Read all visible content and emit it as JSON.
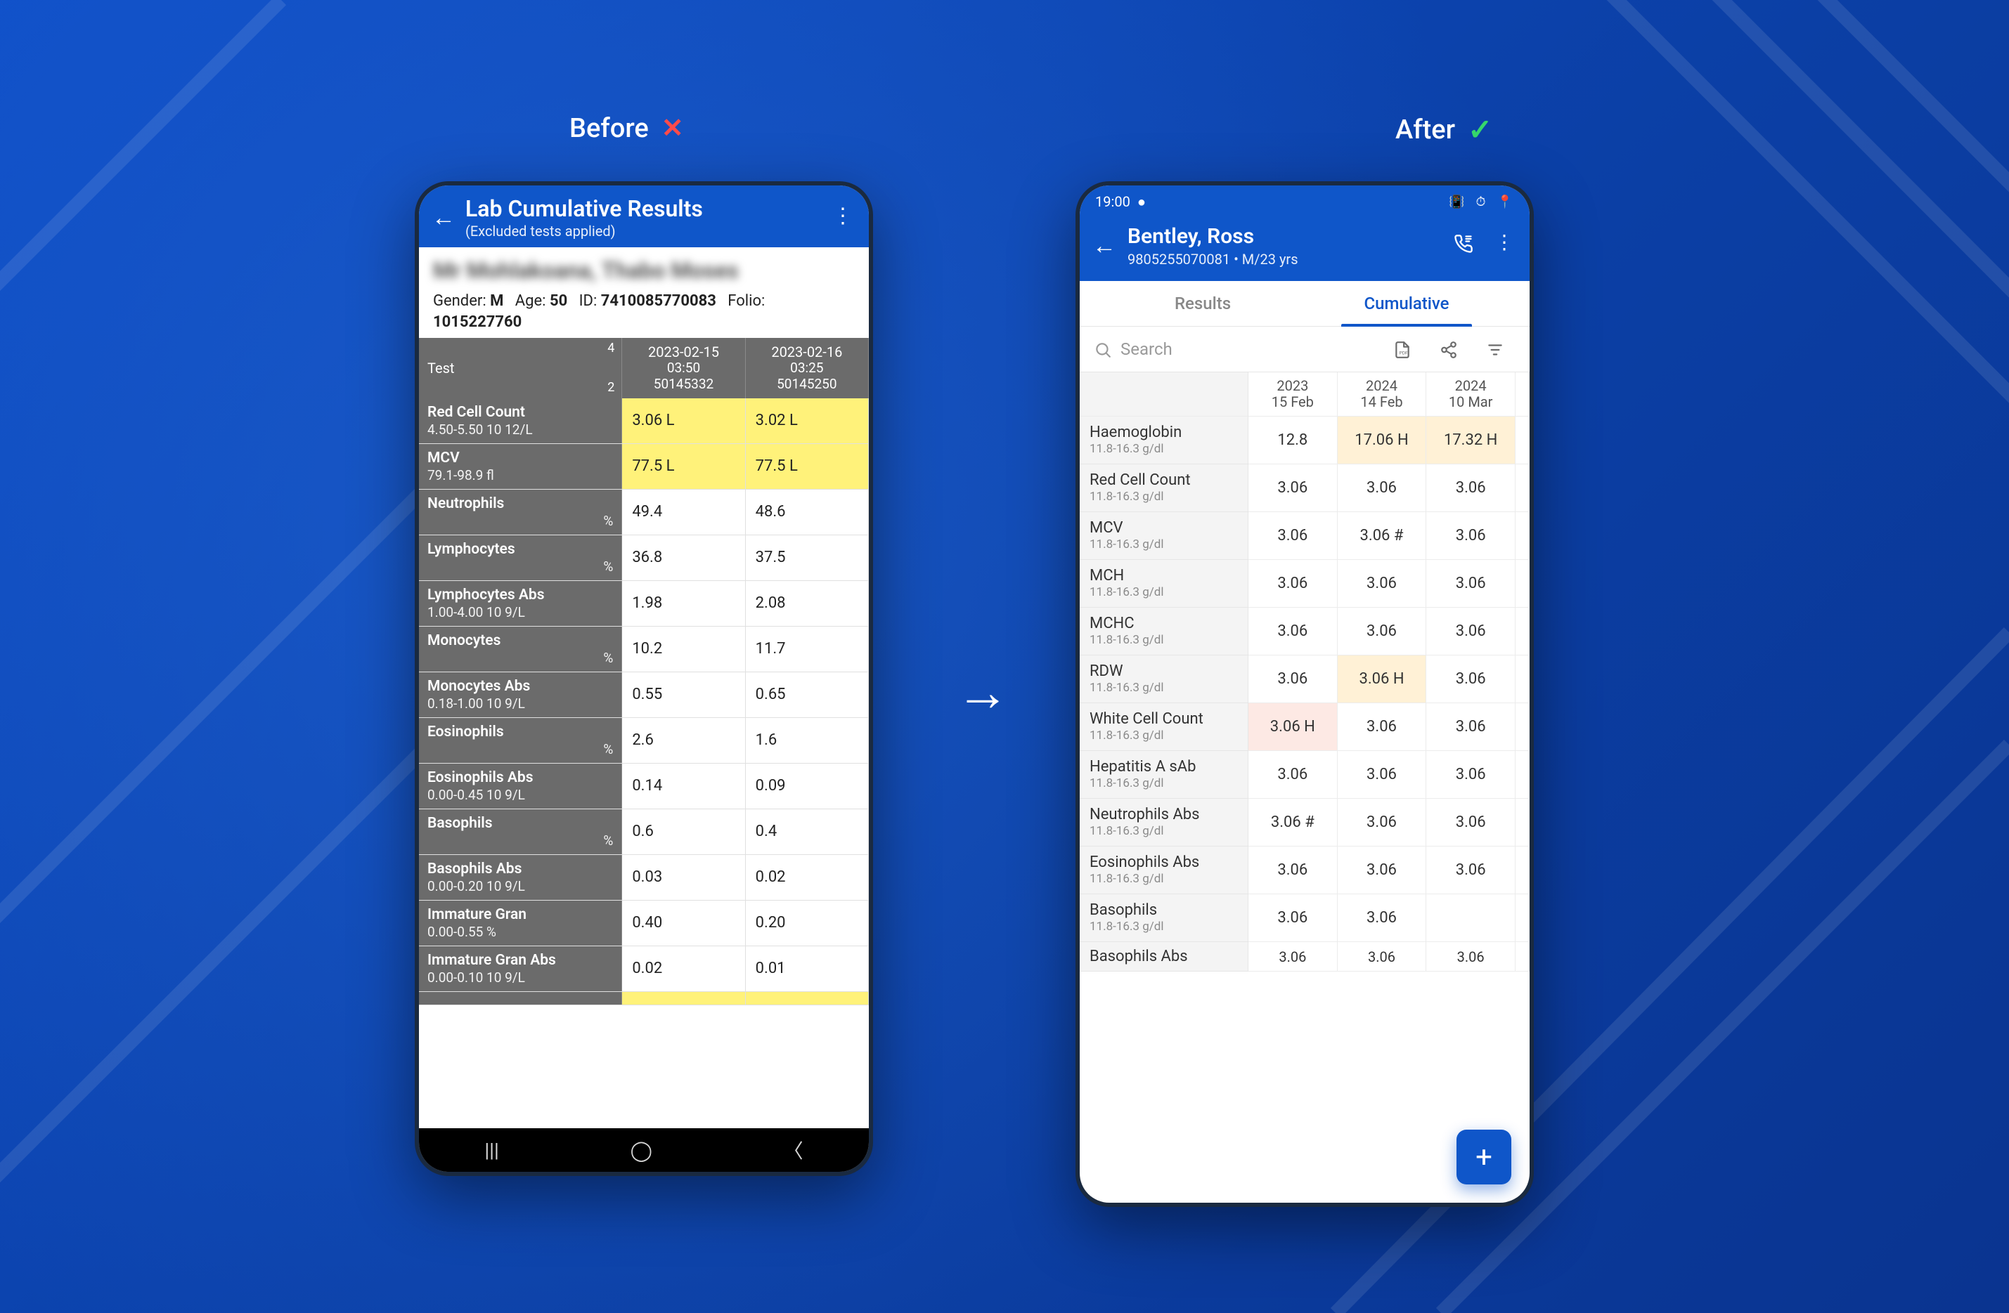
{
  "labels": {
    "before": "Before",
    "after": "After"
  },
  "before": {
    "appbar": {
      "title": "Lab Cumulative Results",
      "subtitle": "(Excluded tests applied)"
    },
    "patient": {
      "name_blur": "Mr Mohlakoana, Thabo Moses",
      "gender_label": "Gender:",
      "gender": "M",
      "age_label": "Age:",
      "age": "50",
      "id_label": "ID:",
      "id": "7410085770083",
      "folio_label": "Folio:",
      "folio": "1015227760"
    },
    "table": {
      "col_test_label": "Test",
      "corner_top": "4",
      "corner_bot": "2",
      "columns": [
        {
          "date": "2023-02-15",
          "time": "03:50",
          "acc": "50145332"
        },
        {
          "date": "2023-02-16",
          "time": "03:25",
          "acc": "50145250"
        }
      ],
      "rows": [
        {
          "name": "Red Cell Count",
          "range": "4.50-5.50    10 12/L",
          "unit_right": false,
          "v1": "3.06 L",
          "f1": true,
          "v2": "3.02 L",
          "f2": true
        },
        {
          "name": "MCV",
          "range": "79.1-98.9     fl",
          "unit_right": false,
          "v1": "77.5 L",
          "f1": true,
          "v2": "77.5 L",
          "f2": true
        },
        {
          "name": "Neutrophils",
          "range": "%",
          "unit_right": true,
          "v1": "49.4",
          "f1": false,
          "v2": "48.6",
          "f2": false
        },
        {
          "name": "Lymphocytes",
          "range": "%",
          "unit_right": true,
          "v1": "36.8",
          "f1": false,
          "v2": "37.5",
          "f2": false
        },
        {
          "name": "Lymphocytes Abs",
          "range": "1.00-4.00    10 9/L",
          "unit_right": false,
          "v1": "1.98",
          "f1": false,
          "v2": "2.08",
          "f2": false
        },
        {
          "name": "Monocytes",
          "range": "%",
          "unit_right": true,
          "v1": "10.2",
          "f1": false,
          "v2": "11.7",
          "f2": false
        },
        {
          "name": "Monocytes Abs",
          "range": "0.18-1.00    10 9/L",
          "unit_right": false,
          "v1": "0.55",
          "f1": false,
          "v2": "0.65",
          "f2": false
        },
        {
          "name": "Eosinophils",
          "range": "%",
          "unit_right": true,
          "v1": "2.6",
          "f1": false,
          "v2": "1.6",
          "f2": false
        },
        {
          "name": "Eosinophils Abs",
          "range": "0.00-0.45    10 9/L",
          "unit_right": false,
          "v1": "0.14",
          "f1": false,
          "v2": "0.09",
          "f2": false
        },
        {
          "name": "Basophils",
          "range": "%",
          "unit_right": true,
          "v1": "0.6",
          "f1": false,
          "v2": "0.4",
          "f2": false
        },
        {
          "name": "Basophils Abs",
          "range": "0.00-0.20    10 9/L",
          "unit_right": false,
          "v1": "0.03",
          "f1": false,
          "v2": "0.02",
          "f2": false
        },
        {
          "name": "Immature Gran",
          "range": "0.00-0.55     %",
          "unit_right": false,
          "v1": "0.40",
          "f1": false,
          "v2": "0.20",
          "f2": false
        },
        {
          "name": "Immature Gran Abs",
          "range": "0.00-0.10    10 9/L",
          "unit_right": false,
          "v1": "0.02",
          "f1": false,
          "v2": "0.01",
          "f2": false
        }
      ]
    }
  },
  "after": {
    "statusbar": {
      "time": "19:00"
    },
    "appbar": {
      "name": "Bentley, Ross",
      "sub": "9805255070081 • M/23 yrs"
    },
    "tabs": {
      "results": "Results",
      "cumulative": "Cumulative"
    },
    "search_placeholder": "Search",
    "table": {
      "columns": [
        {
          "year": "2023",
          "day": "15 Feb"
        },
        {
          "year": "2024",
          "day": "14 Feb"
        },
        {
          "year": "2024",
          "day": "10 Mar"
        }
      ],
      "rows": [
        {
          "name": "Haemoglobin",
          "range": "11.8-16.3  g/dl",
          "v": [
            "12.8",
            "17.06 H",
            "17.32 H"
          ],
          "flags": [
            "",
            "high",
            "high"
          ]
        },
        {
          "name": "Red Cell Count",
          "range": "11.8-16.3  g/dl",
          "v": [
            "3.06",
            "3.06",
            "3.06"
          ],
          "flags": [
            "",
            "",
            ""
          ]
        },
        {
          "name": "MCV",
          "range": "11.8-16.3  g/dl",
          "v": [
            "3.06",
            "3.06 #",
            "3.06"
          ],
          "flags": [
            "",
            "",
            ""
          ]
        },
        {
          "name": "MCH",
          "range": "11.8-16.3  g/dl",
          "v": [
            "3.06",
            "3.06",
            "3.06"
          ],
          "flags": [
            "",
            "",
            ""
          ]
        },
        {
          "name": "MCHC",
          "range": "11.8-16.3  g/dl",
          "v": [
            "3.06",
            "3.06",
            "3.06"
          ],
          "flags": [
            "",
            "",
            ""
          ]
        },
        {
          "name": "RDW",
          "range": "11.8-16.3  g/dl",
          "v": [
            "3.06",
            "3.06 H",
            "3.06"
          ],
          "flags": [
            "",
            "high",
            ""
          ]
        },
        {
          "name": "White Cell Count",
          "range": "11.8-16.3  g/dl",
          "v": [
            "3.06 H",
            "3.06",
            "3.06"
          ],
          "flags": [
            "high-red",
            "",
            ""
          ]
        },
        {
          "name": "Hepatitis A sAb",
          "range": "11.8-16.3  g/dl",
          "v": [
            "3.06",
            "3.06",
            "3.06"
          ],
          "flags": [
            "",
            "",
            ""
          ]
        },
        {
          "name": "Neutrophils Abs",
          "range": "11.8-16.3  g/dl",
          "v": [
            "3.06 #",
            "3.06",
            "3.06"
          ],
          "flags": [
            "",
            "",
            ""
          ]
        },
        {
          "name": "Eosinophils Abs",
          "range": "11.8-16.3  g/dl",
          "v": [
            "3.06",
            "3.06",
            "3.06"
          ],
          "flags": [
            "",
            "",
            ""
          ]
        },
        {
          "name": "Basophils",
          "range": "11.8-16.3  g/dl",
          "v": [
            "3.06",
            "3.06",
            ""
          ],
          "flags": [
            "",
            "",
            ""
          ]
        },
        {
          "name": "Basophils Abs",
          "range": "",
          "v": [
            "3.06",
            "3.06",
            "3.06"
          ],
          "flags": [
            "",
            "",
            ""
          ],
          "partial": true
        }
      ]
    }
  }
}
